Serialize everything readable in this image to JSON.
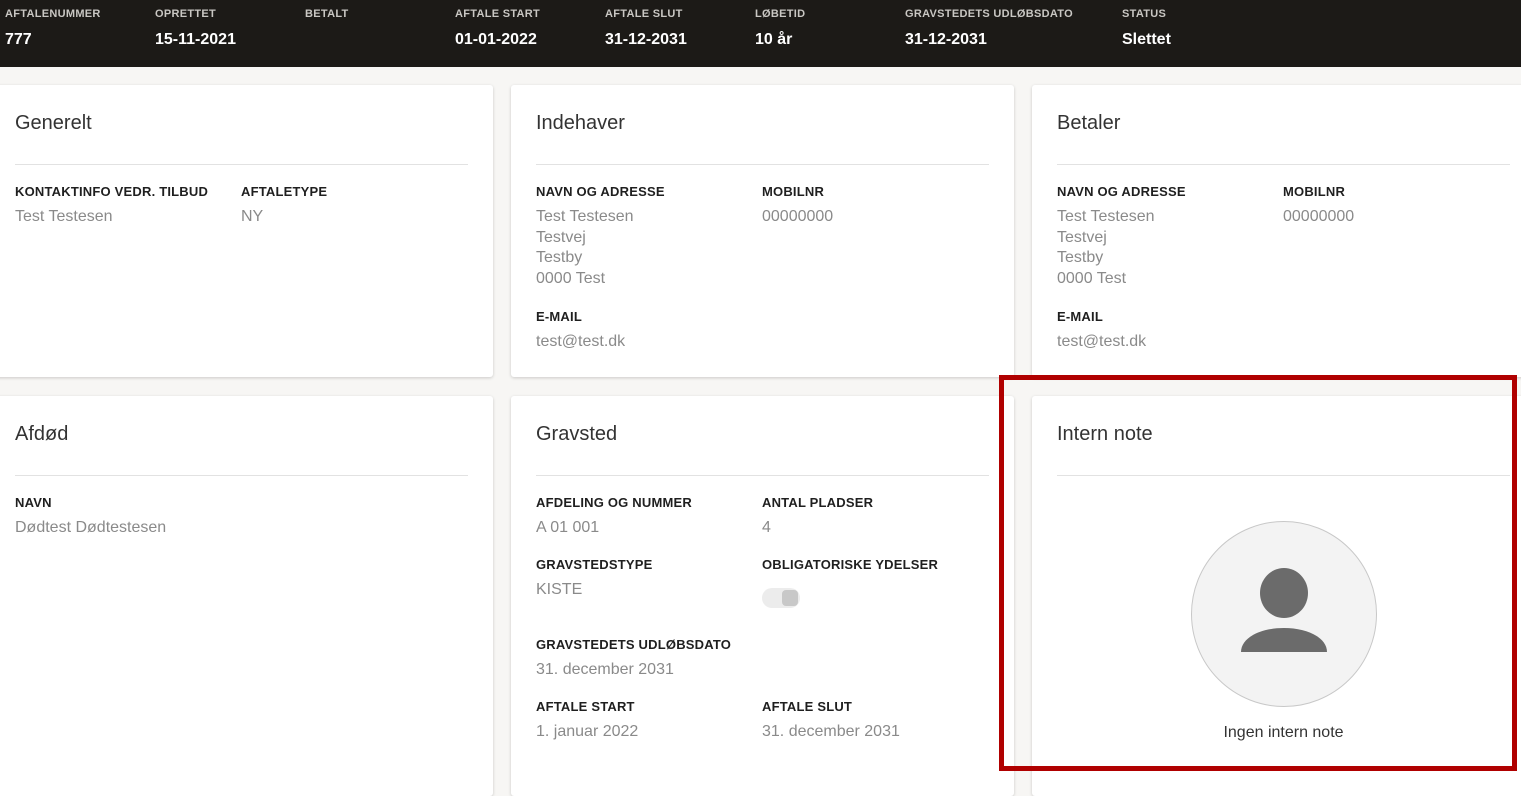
{
  "topbar": {
    "fields": [
      {
        "label": "AFTALENUMMER",
        "value": "777"
      },
      {
        "label": "OPRETTET",
        "value": "15-11-2021"
      },
      {
        "label": "BETALT",
        "value": ""
      },
      {
        "label": "AFTALE START",
        "value": "01-01-2022"
      },
      {
        "label": "AFTALE SLUT",
        "value": "31-12-2031"
      },
      {
        "label": "LØBETID",
        "value": "10 år"
      },
      {
        "label": "GRAVSTEDETS UDLØBSDATO",
        "value": "31-12-2031"
      },
      {
        "label": "STATUS",
        "value": "Slettet"
      }
    ]
  },
  "generelt": {
    "title": "Generelt",
    "kontakt_label": "KONTAKTINFO VEDR. TILBUD",
    "kontakt_value": "Test Testesen",
    "aftaletype_label": "AFTALETYPE",
    "aftaletype_value": "NY"
  },
  "indehaver": {
    "title": "Indehaver",
    "navn_label": "NAVN OG ADRESSE",
    "navn_lines": [
      "Test Testesen",
      "Testvej",
      "Testby",
      "0000 Test"
    ],
    "mobil_label": "MOBILNR",
    "mobil_value": "00000000",
    "email_label": "E-MAIL",
    "email_value": "test@test.dk"
  },
  "betaler": {
    "title": "Betaler",
    "navn_label": "NAVN OG ADRESSE",
    "navn_lines": [
      "Test Testesen",
      "Testvej",
      "Testby",
      "0000 Test"
    ],
    "mobil_label": "MOBILNR",
    "mobil_value": "00000000",
    "email_label": "E-MAIL",
    "email_value": "test@test.dk"
  },
  "afdoed": {
    "title": "Afdød",
    "navn_label": "NAVN",
    "navn_value": "Dødtest Dødtestesen"
  },
  "gravsted": {
    "title": "Gravsted",
    "afdeling_label": "AFDELING OG NUMMER",
    "afdeling_value": "A 01 001",
    "pladser_label": "ANTAL PLADSER",
    "pladser_value": "4",
    "type_label": "GRAVSTEDSTYPE",
    "type_value": "KISTE",
    "ydelser_label": "OBLIGATORISKE YDELSER",
    "ydelser_on": false,
    "udloeb_label": "GRAVSTEDETS UDLØBSDATO",
    "udloeb_value": "31. december 2031",
    "start_label": "AFTALE START",
    "start_value": "1. januar 2022",
    "slut_label": "AFTALE SLUT",
    "slut_value": "31. december 2031"
  },
  "intern_note": {
    "title": "Intern note",
    "empty_text": "Ingen intern note"
  },
  "colors": {
    "topbar_bg": "#1c1a17",
    "highlight": "#b00000",
    "muted_text": "#8a8a8a"
  }
}
